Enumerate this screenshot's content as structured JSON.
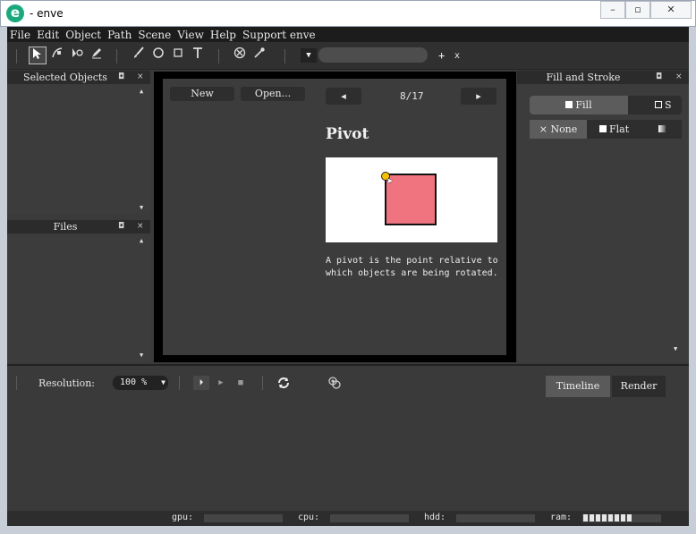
{
  "window": {
    "title": "- enve",
    "logo_letter": "e",
    "minimize_icon": "–",
    "maximize_icon": "▫",
    "close_icon": "✕"
  },
  "menu": [
    "File",
    "Edit",
    "Object",
    "Path",
    "Scene",
    "View",
    "Help",
    "Support enve"
  ],
  "toolbar": {
    "tools": [
      "pointer-icon",
      "node-select-icon",
      "pivot-icon",
      "pen-icon",
      "brush-icon",
      "circle-icon",
      "rectangle-icon",
      "text-icon",
      "null-object-icon",
      "eyedropper-icon"
    ],
    "combo_arrow": "▼",
    "plus": "+",
    "x": "x"
  },
  "panels": {
    "selected_objects": {
      "title": "Selected Objects",
      "pin": "◘",
      "close": "×"
    },
    "files": {
      "title": "Files",
      "pin": "◘",
      "close": "×"
    },
    "fill_stroke": {
      "title": "Fill and Stroke",
      "pin": "◘",
      "close": "×"
    }
  },
  "welcome": {
    "new_label": "New",
    "open_label": "Open...",
    "prev_label": "◂",
    "next_label": "▸",
    "page_counter": "8/17",
    "heading": "Pivot",
    "description": "A pivot is the point relative to which objects are being rotated."
  },
  "fill_stroke": {
    "tab_fill": "Fill",
    "tab_stroke": "S",
    "opt_none": "None",
    "opt_flat": "Flat",
    "none_icon": "×"
  },
  "timeline": {
    "resolution_label": "Resolution:",
    "resolution_value": "100 %",
    "resolution_arrow": "▼",
    "play_from_start": "⏵",
    "play": "▶",
    "stop": "■",
    "timeline_tab": "Timeline",
    "render_tab": "Render"
  },
  "status": {
    "gpu_label": "gpu:",
    "cpu_label": "cpu:",
    "hdd_label": "hdd:",
    "ram_label": "ram:",
    "ram_blocks": 8
  },
  "colors": {
    "accent_logo": "#1aa97c",
    "demo_square": "#ef7480",
    "pivot_marker": "#f6c300"
  }
}
